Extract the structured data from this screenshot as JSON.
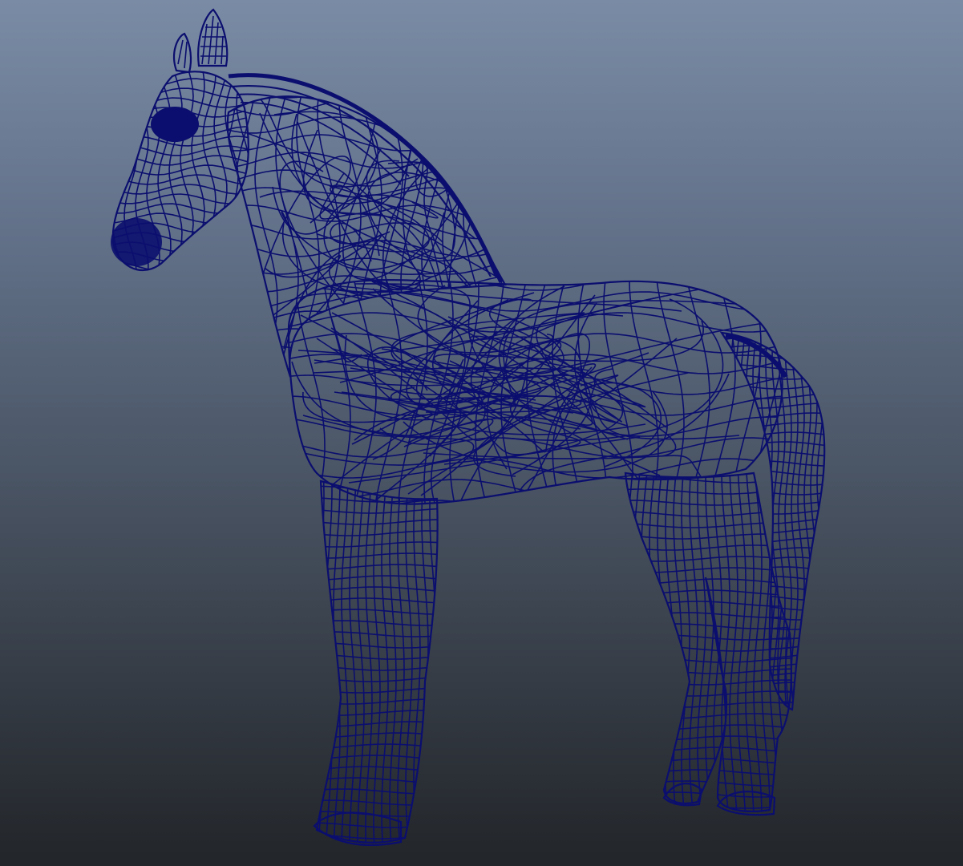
{
  "viewport": {
    "mode": "wireframe",
    "model": "horse-icon",
    "wire_color": "#0b0e6e",
    "gradient_top": "#7a8ba5",
    "gradient_bottom": "#222529"
  }
}
